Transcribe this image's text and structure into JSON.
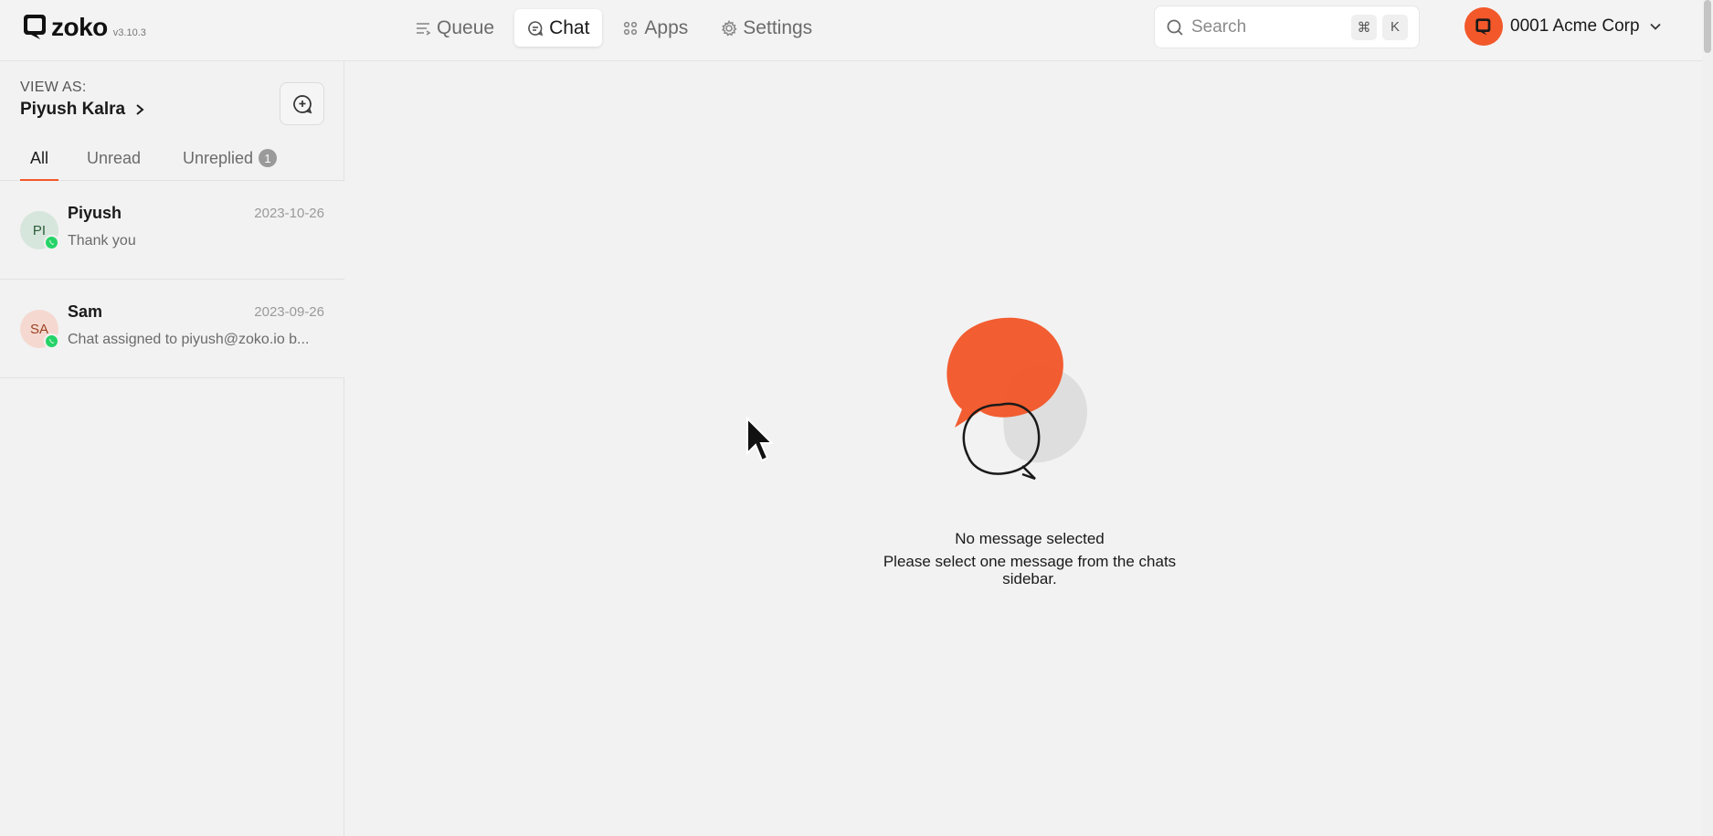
{
  "app": {
    "logo_text": "zoko",
    "version": "v3.10.3"
  },
  "nav": {
    "items": [
      {
        "label": "Queue",
        "icon": "queue-icon",
        "active": false
      },
      {
        "label": "Chat",
        "icon": "chat-icon",
        "active": true
      },
      {
        "label": "Apps",
        "icon": "apps-icon",
        "active": false
      },
      {
        "label": "Settings",
        "icon": "gear-icon",
        "active": false
      }
    ]
  },
  "search": {
    "placeholder": "Search",
    "shortcut_keys": [
      "⌘",
      "K"
    ]
  },
  "account": {
    "name": "0001 Acme Corp",
    "accent": "#f2582a"
  },
  "sidebar": {
    "view_as_label": "VIEW AS:",
    "view_as_name": "Piyush Kalra",
    "tabs": [
      {
        "label": "All",
        "active": true
      },
      {
        "label": "Unread",
        "active": false
      },
      {
        "label": "Unreplied",
        "active": false,
        "badge": "1"
      }
    ],
    "chats": [
      {
        "initials": "PI",
        "name": "Piyush",
        "date": "2023-10-26",
        "preview": "Thank you",
        "avatar_bg": "#d6e6dc",
        "avatar_fg": "#2e5c3a"
      },
      {
        "initials": "SA",
        "name": "Sam",
        "date": "2023-09-26",
        "preview": "Chat assigned to piyush@zoko.io b...",
        "avatar_bg": "#f5d9d0",
        "avatar_fg": "#9a3f22"
      }
    ]
  },
  "empty_state": {
    "title": "No message selected",
    "subtitle": "Please select one message from the chats sidebar."
  },
  "colors": {
    "accent": "#f2582a",
    "whatsapp": "#25d366"
  }
}
